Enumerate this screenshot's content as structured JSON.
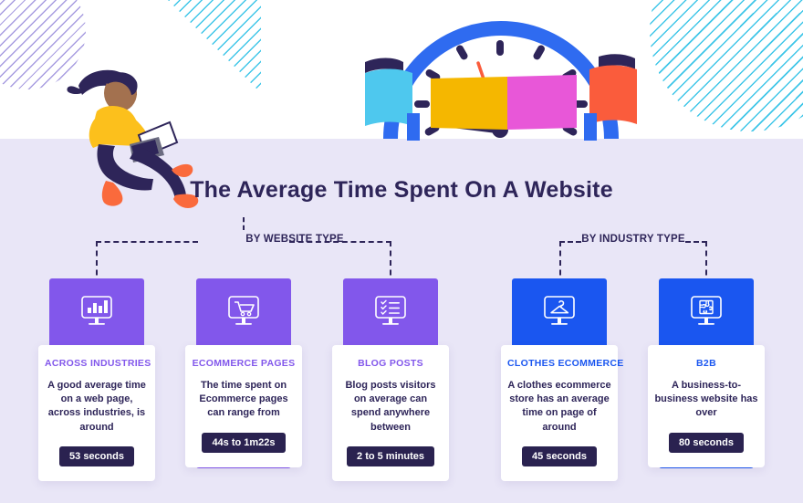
{
  "title": "The Average Time Spent On A Website",
  "colors": {
    "hero_bg": "#ffffff",
    "body_bg": "#e9e6f7",
    "purple": "#8257eb",
    "blue": "#1a56f0",
    "navy": "#2e2559",
    "badge_bg": "#2a2250",
    "cyan_stripe": "#3fc6e8",
    "purple_stripe": "#a79ce0"
  },
  "groups": [
    {
      "label": "BY WEBSITE TYPE",
      "name": "by-website-type"
    },
    {
      "label": "BY INDUSTRY TYPE",
      "name": "by-industry-type"
    }
  ],
  "cards": [
    {
      "category": "ACROSS INDUSTRIES",
      "description": "A good average time on a web page, across industries, is around",
      "value": "53 seconds",
      "icon": "monitor-bar-chart-icon",
      "accent": "#8257eb",
      "group": "BY WEBSITE TYPE"
    },
    {
      "category": "ECOMMERCE PAGES",
      "description": "The time spent on Ecommerce pages can range from",
      "value": "44s to 1m22s",
      "icon": "monitor-shopping-cart-icon",
      "accent": "#8257eb",
      "group": "BY WEBSITE TYPE"
    },
    {
      "category": "BLOG POSTS",
      "description": "Blog posts visitors on average can spend anywhere between",
      "value": "2 to 5 minutes",
      "icon": "monitor-checklist-icon",
      "accent": "#8257eb",
      "group": "BY WEBSITE TYPE"
    },
    {
      "category": "CLOTHES ECOMMERCE",
      "description": "A clothes ecommerce store has an average time on page of around",
      "value": "45 seconds",
      "icon": "monitor-clothes-hanger-icon",
      "accent": "#1a56f0",
      "group": "BY INDUSTRY TYPE"
    },
    {
      "category": "B2B",
      "description": "A business-to-business website has over",
      "value": "80 seconds",
      "icon": "monitor-puzzle-icon",
      "accent": "#1a56f0",
      "group": "BY INDUSTRY TYPE"
    }
  ],
  "illustrations": {
    "person": "woman-sitting-with-laptop-illustration",
    "clock": "clock-with-colored-banners-illustration",
    "banner_colors": [
      "#4ec8ee",
      "#f5b700",
      "#e857d8",
      "#fa5c3c"
    ]
  }
}
